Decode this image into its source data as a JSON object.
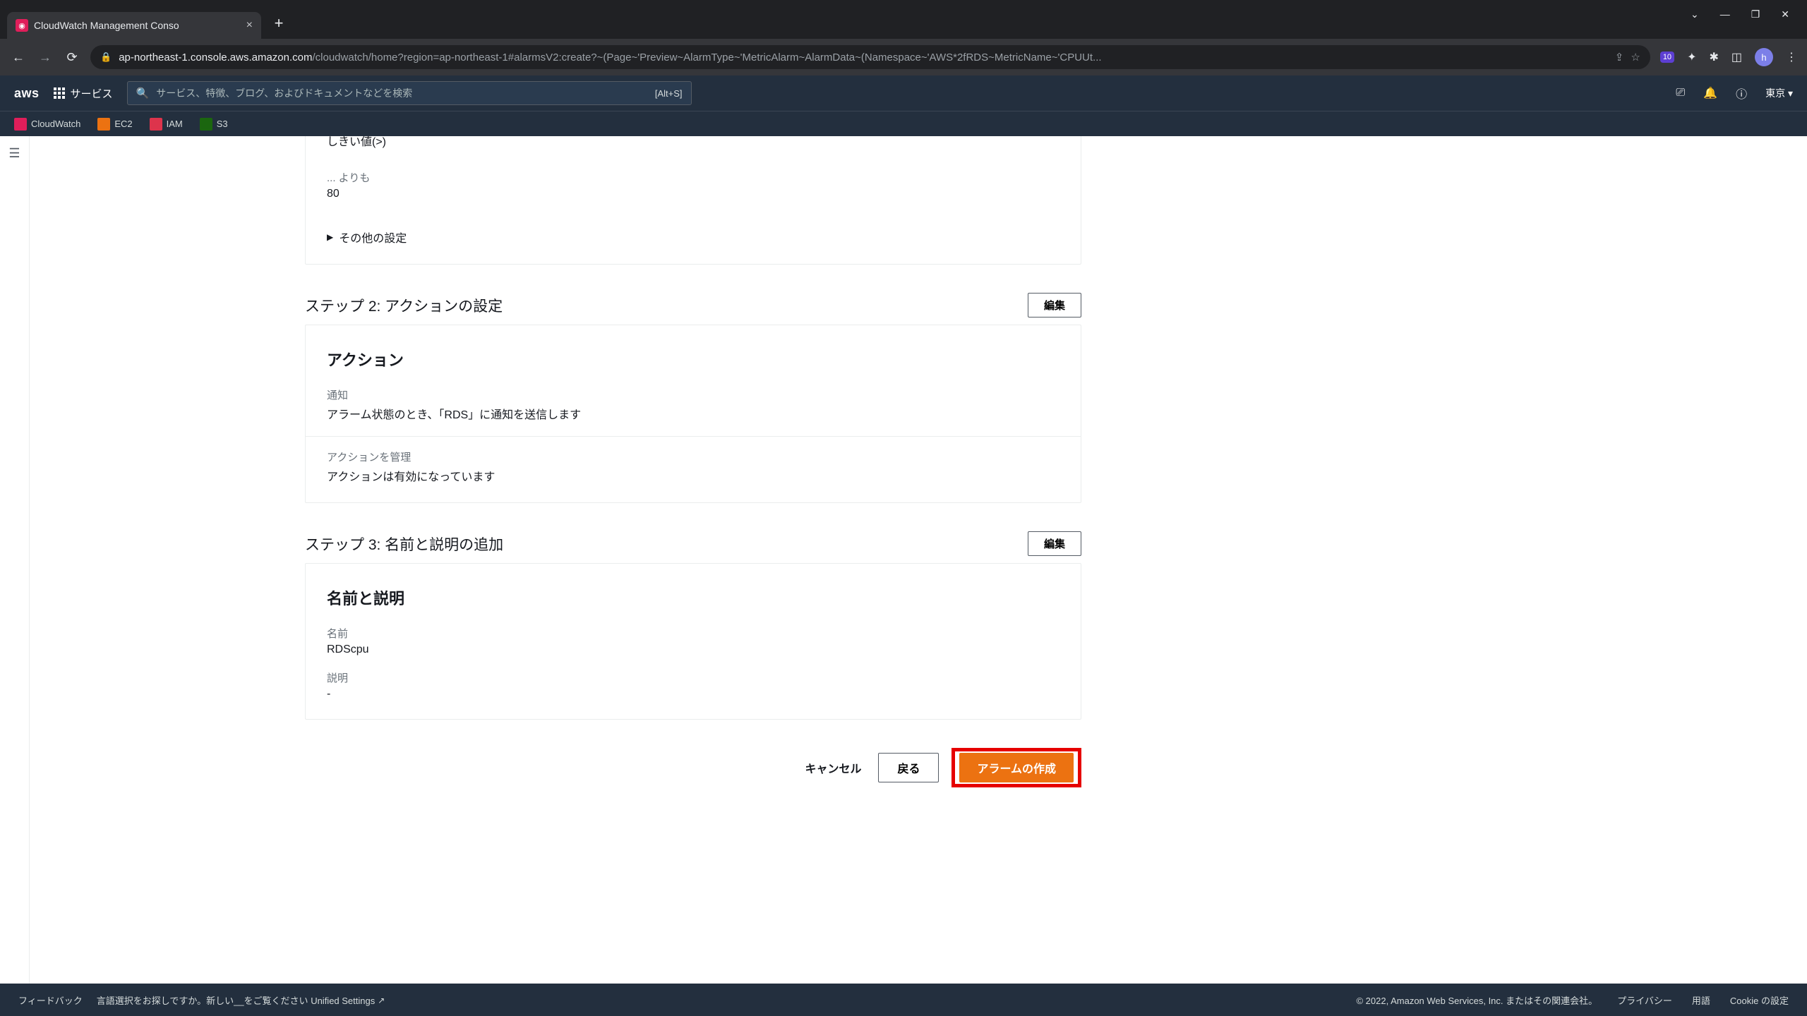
{
  "browser": {
    "tab_title": "CloudWatch Management Conso",
    "url_domain": "ap-northeast-1.console.aws.amazon.com",
    "url_path": "/cloudwatch/home?region=ap-northeast-1#alarmsV2:create?~(Page~'Preview~AlarmType~'MetricAlarm~AlarmData~(Namespace~'AWS*2fRDS~MetricName~'CPUUt...",
    "avatar_letter": "h",
    "ext_badge": "10"
  },
  "aws": {
    "logo": "aws",
    "services_label": "サービス",
    "search_placeholder": "サービス、特徴、ブログ、およびドキュメントなどを検索",
    "search_hint": "[Alt+S]",
    "region": "東京 ▾",
    "bookmarks": {
      "cw": "CloudWatch",
      "ec2": "EC2",
      "iam": "IAM",
      "s3": "S3"
    }
  },
  "conditions": {
    "comp_label": "しきい値(>)",
    "than_label": "... よりも",
    "than_value": "80",
    "other_settings": "その他の設定"
  },
  "step2": {
    "title": "ステップ 2: アクションの設定",
    "edit": "編集",
    "panel_title": "アクション",
    "notify_label": "通知",
    "notify_value": "アラーム状態のとき、「RDS」に通知を送信します",
    "manage_label": "アクションを管理",
    "manage_value": "アクションは有効になっています"
  },
  "step3": {
    "title": "ステップ 3: 名前と説明の追加",
    "edit": "編集",
    "panel_title": "名前と説明",
    "name_label": "名前",
    "name_value": "RDScpu",
    "desc_label": "説明",
    "desc_value": "-"
  },
  "buttons": {
    "cancel": "キャンセル",
    "back": "戻る",
    "create": "アラームの作成"
  },
  "footer": {
    "feedback": "フィードバック",
    "lang_prompt": "言語選択をお探しですか。新しい__をご覧ください ",
    "unified": "Unified Settings",
    "copyright": "© 2022, Amazon Web Services, Inc. またはその関連会社。",
    "privacy": "プライバシー",
    "terms": "用語",
    "cookie": "Cookie の設定"
  }
}
